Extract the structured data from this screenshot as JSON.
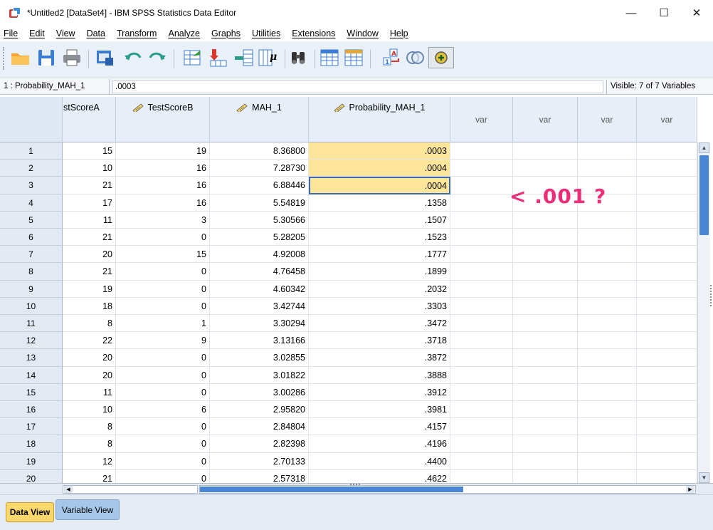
{
  "window": {
    "title": "*Untitled2 [DataSet4] - IBM SPSS Statistics Data Editor",
    "controls": [
      "—",
      "☐",
      "✕"
    ]
  },
  "menu": [
    "File",
    "Edit",
    "View",
    "Data",
    "Transform",
    "Analyze",
    "Graphs",
    "Utilities",
    "Extensions",
    "Window",
    "Help"
  ],
  "toolbar": {
    "icons": [
      "open-folder-icon",
      "save-icon",
      "print-icon",
      "dialog-recall-icon",
      "undo-icon",
      "redo-icon",
      "go-to-case-icon",
      "go-to-variable-icon",
      "variables-icon",
      "descriptive-statistics-icon",
      "find-icon",
      "insert-cases-icon",
      "split-file-icon",
      "value-labels-icon",
      "use-sets-icon",
      "show-all-variables-icon"
    ],
    "accent_color": "#3a7bd5"
  },
  "cellref": {
    "name": "1 : Probability_MAH_1",
    "value": ".0003",
    "visible": "Visible: 7 of 7 Variables"
  },
  "grid": {
    "headers": [
      "stScoreA",
      "TestScoreB",
      "MAH_1",
      "Probability_MAH_1",
      "var",
      "var",
      "var",
      "var"
    ],
    "rows": [
      [
        "1",
        "15",
        "19",
        "8.36800",
        ".0003"
      ],
      [
        "2",
        "10",
        "16",
        "7.28730",
        ".0004"
      ],
      [
        "3",
        "21",
        "16",
        "6.88446",
        ".0004"
      ],
      [
        "4",
        "17",
        "16",
        "5.54819",
        ".1358"
      ],
      [
        "5",
        "11",
        "3",
        "5.30566",
        ".1507"
      ],
      [
        "6",
        "21",
        "0",
        "5.28205",
        ".1523"
      ],
      [
        "7",
        "20",
        "15",
        "4.92008",
        ".1777"
      ],
      [
        "8",
        "21",
        "0",
        "4.76458",
        ".1899"
      ],
      [
        "9",
        "19",
        "0",
        "4.60342",
        ".2032"
      ],
      [
        "10",
        "18",
        "0",
        "3.42744",
        ".3303"
      ],
      [
        "11",
        "8",
        "1",
        "3.30294",
        ".3472"
      ],
      [
        "12",
        "22",
        "9",
        "3.13166",
        ".3718"
      ],
      [
        "13",
        "20",
        "0",
        "3.02855",
        ".3872"
      ],
      [
        "14",
        "20",
        "0",
        "3.01822",
        ".3888"
      ],
      [
        "15",
        "11",
        "0",
        "3.00286",
        ".3912"
      ],
      [
        "16",
        "10",
        "6",
        "2.95820",
        ".3981"
      ],
      [
        "17",
        "8",
        "0",
        "2.84804",
        ".4157"
      ],
      [
        "18",
        "8",
        "0",
        "2.82398",
        ".4196"
      ],
      [
        "19",
        "12",
        "0",
        "2.70133",
        ".4400"
      ],
      [
        "20",
        "21",
        "0",
        "2.57318",
        ".4622"
      ]
    ],
    "highlight_color": "#fde59a"
  },
  "annotation": "< .001 ?",
  "tabs": {
    "data_view": "Data View",
    "variable_view": "Variable View"
  }
}
